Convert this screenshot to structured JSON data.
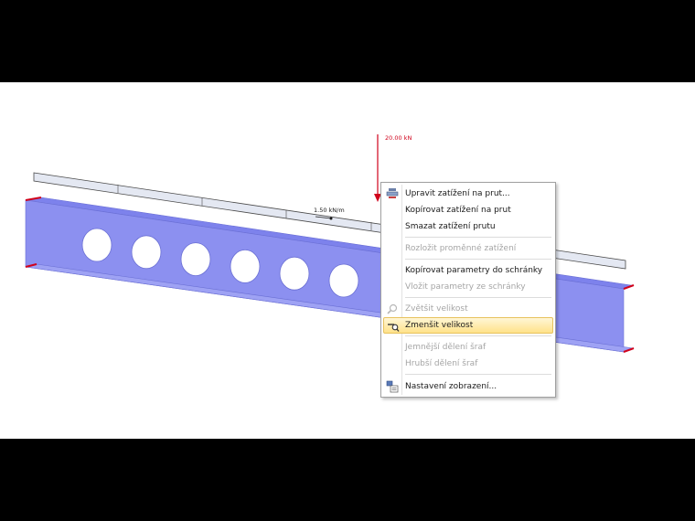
{
  "model": {
    "nodal_load_label": "20.00 kN",
    "line_load_label": "1.50 kN/m",
    "load_color": "#d0021b",
    "beam_color": "#8c90f0",
    "hole_count": 6
  },
  "context_menu": {
    "items": [
      {
        "label": "Upravit zatížení na prut...",
        "enabled": true,
        "icon": "edit-load-icon"
      },
      {
        "label": "Kopírovat zatížení na prut",
        "enabled": true
      },
      {
        "label": "Smazat zatížení prutu",
        "enabled": true
      },
      {
        "label": "Rozložit proměnné zatížení",
        "enabled": false
      },
      {
        "label": "Kopírovat parametry do schránky",
        "enabled": true
      },
      {
        "label": "Vložit parametry ze schránky",
        "enabled": false
      },
      {
        "label": "Zvětšit velikost",
        "enabled": false,
        "icon": "zoom-in-icon"
      },
      {
        "label": "Zmenšit velikost",
        "enabled": true,
        "highlighted": true,
        "icon": "zoom-out-icon"
      },
      {
        "label": "Jemnější dělení šraf",
        "enabled": false
      },
      {
        "label": "Hrubší dělení šraf",
        "enabled": false
      },
      {
        "label": "Nastavení zobrazení...",
        "enabled": true,
        "icon": "display-settings-icon"
      }
    ]
  }
}
